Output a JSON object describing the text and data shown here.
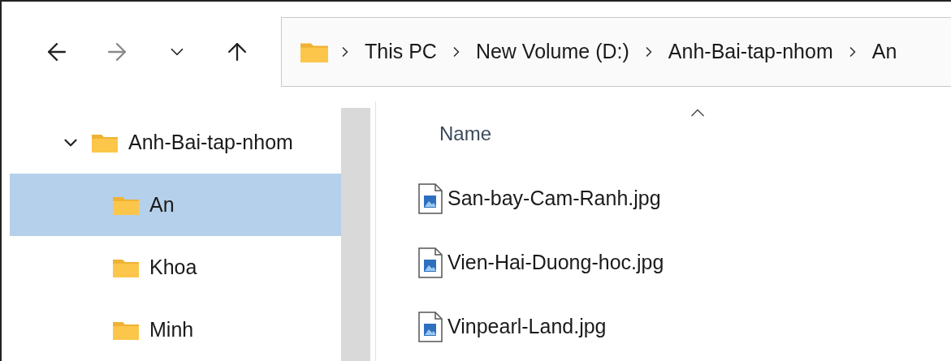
{
  "nav_buttons": [
    {
      "kind": "back",
      "disabled": false
    },
    {
      "kind": "forward",
      "disabled": true
    },
    {
      "kind": "recent",
      "disabled": false
    },
    {
      "kind": "up",
      "disabled": false
    }
  ],
  "address_bar": {
    "segments": [
      "This PC",
      "New Volume (D:)",
      "Anh-Bai-tap-nhom",
      "An"
    ]
  },
  "sidebar": {
    "items": [
      {
        "label": "Anh-Bai-tap-nhom",
        "expanded": true,
        "selected": false,
        "children": [
          {
            "label": "An",
            "selected": true
          },
          {
            "label": "Khoa",
            "selected": false
          },
          {
            "label": "Minh",
            "selected": false
          }
        ]
      }
    ]
  },
  "file_list": {
    "columns": [
      {
        "label": "Name",
        "sorted": true
      }
    ],
    "rows": [
      {
        "name": "San-bay-Cam-Ranh.jpg"
      },
      {
        "name": "Vien-Hai-Duong-hoc.jpg"
      },
      {
        "name": "Vinpearl-Land.jpg"
      }
    ]
  }
}
